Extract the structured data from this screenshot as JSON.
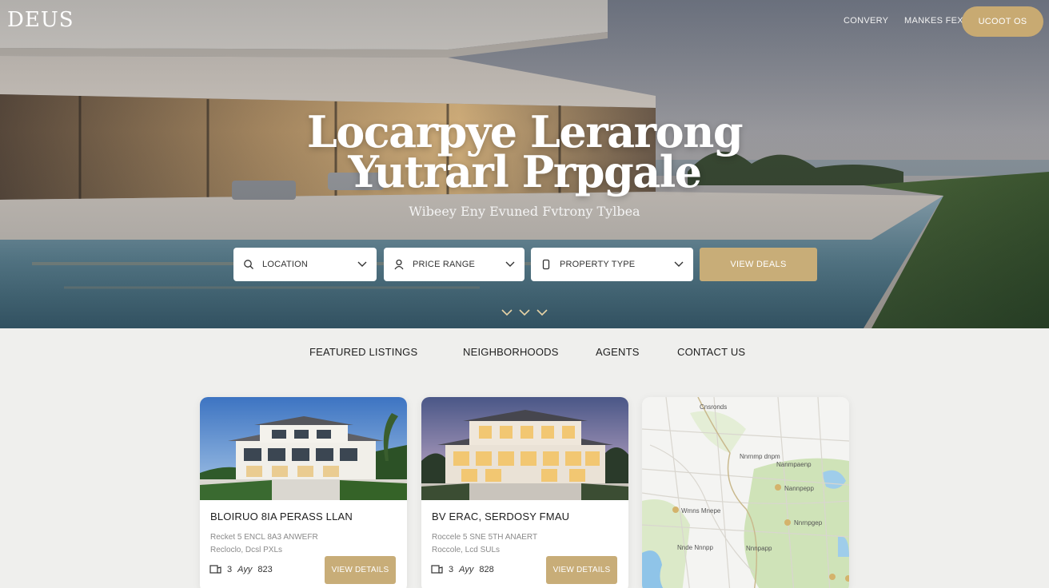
{
  "brand": {
    "logo": "DEUS"
  },
  "top_nav": {
    "links": [
      "CONVERY",
      "MANKES FEX"
    ],
    "cta": "UCOOT OS"
  },
  "hero": {
    "title_line1": "Locarpye Lerarong",
    "title_line2": "Yutrarl Prpgale",
    "subtitle": "Wibeey Eny Evuned Fvtrony Tylbea"
  },
  "search": {
    "location": "LOCATION",
    "price_range": "PRICE RANGE",
    "property_type": "PROPERTY TYPE",
    "button": "VIEW DEALS"
  },
  "main_nav": [
    "FEATURED LISTINGS",
    "NEIGHBORHOODS",
    "AGENTS",
    "CONTACT US"
  ],
  "listings": [
    {
      "title": "BLOIRUO 8IA PERASS LLAN",
      "desc_line1": "Recket 5 ENCL 8A3 ANWEFR",
      "desc_line2": "Recloclo, Dcsl PXLs",
      "beds": "3",
      "meta_text": "Ayy",
      "number": "823",
      "button": "VIEW DETAILS"
    },
    {
      "title": "BV ERAC, SERDOSY FMAU",
      "desc_line1": "Roccele 5 SNE 5TH ANAERT",
      "desc_line2": "Roccole, Lcd SULs",
      "beds": "3",
      "meta_text": "Ayy",
      "number": "828",
      "button": "VIEW DETAILS"
    }
  ],
  "map": {
    "labels": [
      "Cnsronds",
      "Nnrnmp dnpm",
      "Nanmpaenp",
      "Nannpepp",
      "Wmns Mnepe",
      "Nnrnpgep",
      "Nnde Nnnpp",
      "Nnnpapp"
    ]
  }
}
